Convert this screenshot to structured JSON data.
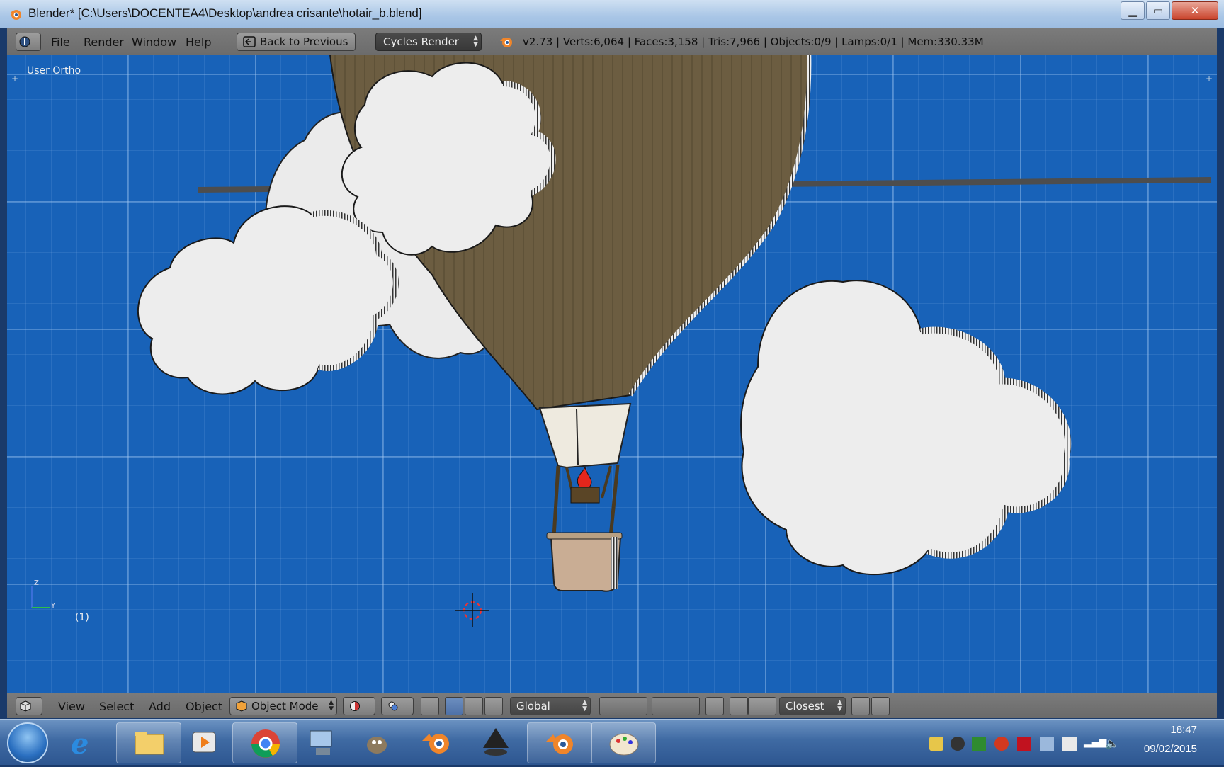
{
  "window": {
    "title": "Blender* [C:\\Users\\DOCENTEA4\\Desktop\\andrea crisante\\hotair_b.blend]",
    "minimize_label": "▁",
    "maximize_label": "▭",
    "close_label": "✕"
  },
  "top_header": {
    "menus": [
      "File",
      "Render",
      "Window",
      "Help"
    ],
    "back_button": "Back to Previous",
    "render_engine": "Cycles Render",
    "stats": "v2.73 | Verts:6,064 | Faces:3,158 | Tris:7,966 | Objects:0/9 | Lamps:0/1 | Mem:330.33M"
  },
  "viewport": {
    "view_label": "User Ortho",
    "frame_label": "(1)",
    "axis_z": "Z",
    "axis_y": "Y"
  },
  "bottom_header": {
    "menus": [
      "View",
      "Select",
      "Add",
      "Object"
    ],
    "mode": "Object Mode",
    "orientation": "Global",
    "snap": "Closest"
  },
  "taskbar": {
    "time": "18:47",
    "date": "09/02/2015",
    "apps": [
      "internet-explorer",
      "file-explorer",
      "media-player",
      "chrome",
      "network-tool",
      "gimp",
      "blender",
      "inkscape",
      "blender",
      "paint"
    ]
  },
  "colors": {
    "viewport_bg": "#1862b8",
    "balloon": "#6e5f43",
    "cloud": "#ececec",
    "header": "#727272"
  }
}
